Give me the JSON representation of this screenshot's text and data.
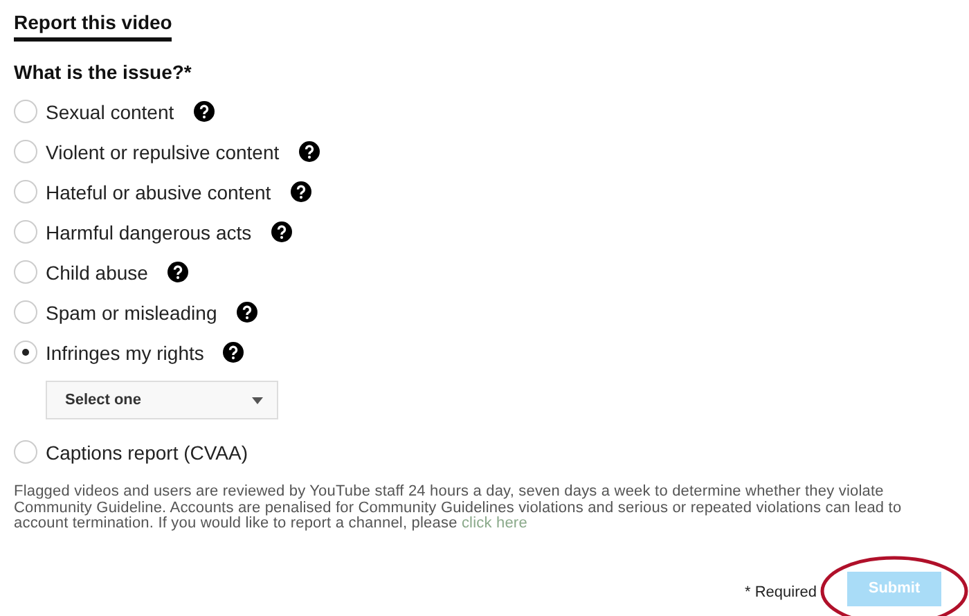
{
  "title": "Report this video",
  "question": "What is the issue?*",
  "options": [
    {
      "label": "Sexual content",
      "selected": false,
      "help": true
    },
    {
      "label": "Violent or repulsive content",
      "selected": false,
      "help": true
    },
    {
      "label": "Hateful or abusive content",
      "selected": false,
      "help": true
    },
    {
      "label": "Harmful dangerous acts",
      "selected": false,
      "help": true
    },
    {
      "label": "Child abuse",
      "selected": false,
      "help": true
    },
    {
      "label": "Spam or misleading",
      "selected": false,
      "help": true
    },
    {
      "label": "Infringes my rights",
      "selected": true,
      "help": true,
      "dropdown": {
        "value": "Select one"
      }
    },
    {
      "label": "Captions report (CVAA)",
      "selected": false,
      "help": false
    }
  ],
  "notice": {
    "text": "Flagged videos and users are reviewed by YouTube staff 24 hours a day, seven days a week to determine whether they violate Community Guideline. Accounts are penalised for Community Guidelines violations and serious or repeated violations can lead to account termination. If you would like to report a channel, please ",
    "link": "click here"
  },
  "footer": {
    "required": "* Required",
    "submit": {
      "label": "Submit",
      "disabled": true,
      "highlighted": true
    }
  }
}
